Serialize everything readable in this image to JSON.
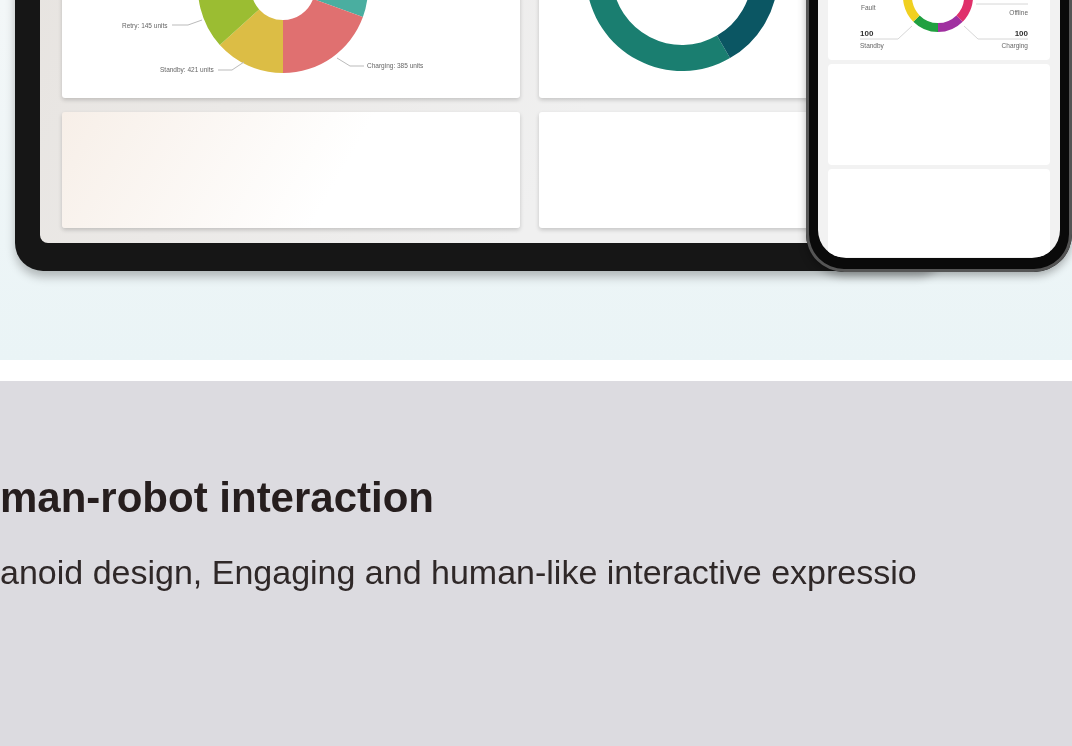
{
  "tablet": {
    "status_donut": {
      "labels": [
        "Retry: 145 units",
        "Standby: 421 units",
        "Charging: 385 units"
      ]
    }
  },
  "phone": {
    "status_ring": {
      "labels": [
        {
          "name": "Fault"
        },
        {
          "name": "Offline"
        },
        {
          "value": "100",
          "name": "Standby"
        },
        {
          "value": "100",
          "name": "Charging"
        }
      ]
    }
  },
  "section": {
    "heading": "man-robot interaction",
    "subtitle": "anoid design, Engaging and human-like interactive expressio"
  }
}
